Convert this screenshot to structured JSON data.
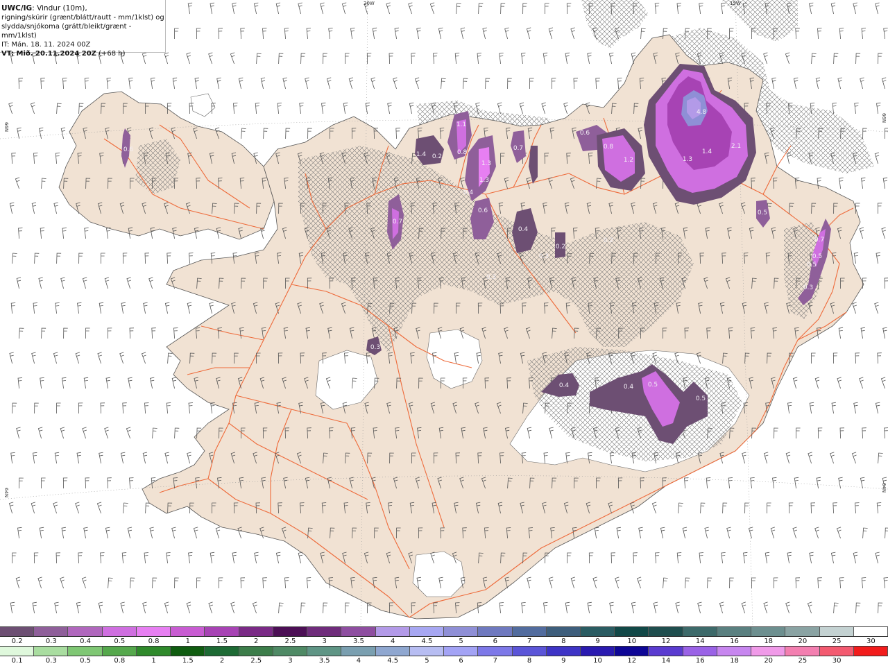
{
  "header": {
    "title_bold": "UWC/IG",
    "title_rest": ": Vindur (10m),",
    "line2": "rigning/skúrir (grænt/blátt/rautt - mm/1klst) og",
    "line3": "slydda/snjókoma (grátt/bleikt/grænt - mm/1klst)",
    "it_line": "IT: Mán. 18. 11. 2024 00Z",
    "vt_bold": "VT: Mið. 20.11.2024 20Z",
    "vt_rest": " (+68 h)"
  },
  "map": {
    "grid_labels": {
      "top_20w": "20W",
      "top_15w": "15W",
      "left_66n": "66N",
      "right_66n": "66N",
      "left_64n": "64N",
      "right_64n": "64N"
    },
    "colors": {
      "land": "#f1e2d3",
      "roads": "#ee6a3a",
      "sea": "#ffffff",
      "glacier": "#ffffff",
      "barbs": "#555555",
      "hatch": "#777777"
    },
    "precip_labels": [
      {
        "text": "0.6"
      },
      {
        "text": "0.7"
      },
      {
        "text": "1.4"
      },
      {
        "text": "0.2"
      },
      {
        "text": "1.1"
      },
      {
        "text": "0.8"
      },
      {
        "text": "1.3"
      },
      {
        "text": "1.3"
      },
      {
        "text": "0.4"
      },
      {
        "text": "0.6"
      },
      {
        "text": "0.7"
      },
      {
        "text": "0.4"
      },
      {
        "text": "0.2"
      },
      {
        "text": "0.3"
      },
      {
        "text": "0.3"
      },
      {
        "text": "0.6"
      },
      {
        "text": "0.8"
      },
      {
        "text": "1.2"
      },
      {
        "text": "4.8"
      },
      {
        "text": "1.4"
      },
      {
        "text": "2.1"
      },
      {
        "text": "1.3"
      },
      {
        "text": "0.5"
      },
      {
        "text": "0.2"
      },
      {
        "text": "0.7"
      },
      {
        "text": "0.5"
      },
      {
        "text": "0.5"
      },
      {
        "text": "0.3"
      },
      {
        "text": "0.3"
      },
      {
        "text": "0.4"
      },
      {
        "text": "0.4"
      },
      {
        "text": "0.5"
      },
      {
        "text": "0.5"
      }
    ]
  },
  "legend_snow": {
    "labels": [
      "0.2",
      "0.3",
      "0.4",
      "0.5",
      "0.8",
      "1",
      "1.5",
      "2",
      "2.5",
      "3",
      "3.5",
      "4",
      "4.5",
      "5",
      "6",
      "7",
      "8",
      "9",
      "10",
      "12",
      "14",
      "16",
      "18",
      "20",
      "25",
      "30"
    ],
    "colors": [
      "#6d4f73",
      "#8f5f9a",
      "#b067bd",
      "#cf6fe0",
      "#e77ff2",
      "#c85cd2",
      "#a743b4",
      "#7a2a86",
      "#4c0f55",
      "#6f2c7b",
      "#8e4ea0",
      "#b39ae8",
      "#a7a7f2",
      "#8f8fd6",
      "#6f79bf",
      "#526c9e",
      "#3e5e7c",
      "#2b5c62",
      "#124847",
      "#1f4e4e",
      "#3d6a6a",
      "#5a8080",
      "#6d8f8f",
      "#8aa3a3",
      "#c4d2d2",
      "#ffffff"
    ]
  },
  "legend_rain": {
    "labels": [
      "0.1",
      "0.3",
      "0.5",
      "0.8",
      "1",
      "1.5",
      "2",
      "2.5",
      "3",
      "3.5",
      "4",
      "4.5",
      "5",
      "6",
      "7",
      "8",
      "9",
      "10",
      "12",
      "14",
      "16",
      "18",
      "20",
      "25",
      "30"
    ],
    "colors": [
      "#dff8dc",
      "#a9dda0",
      "#7fc774",
      "#55a84c",
      "#2f8a2b",
      "#0f5c10",
      "#1d6a34",
      "#3c7d4a",
      "#4f8a65",
      "#5f9585",
      "#7a9fb0",
      "#8fa7d0",
      "#b7bdf2",
      "#a3a3f5",
      "#7d78e8",
      "#5b55d8",
      "#3e34c6",
      "#2a1ab0",
      "#0e0696",
      "#5a3bd0",
      "#9a62e6",
      "#c786ef",
      "#f09ae8",
      "#f37fb0",
      "#f35a70",
      "#f21c1c"
    ]
  }
}
